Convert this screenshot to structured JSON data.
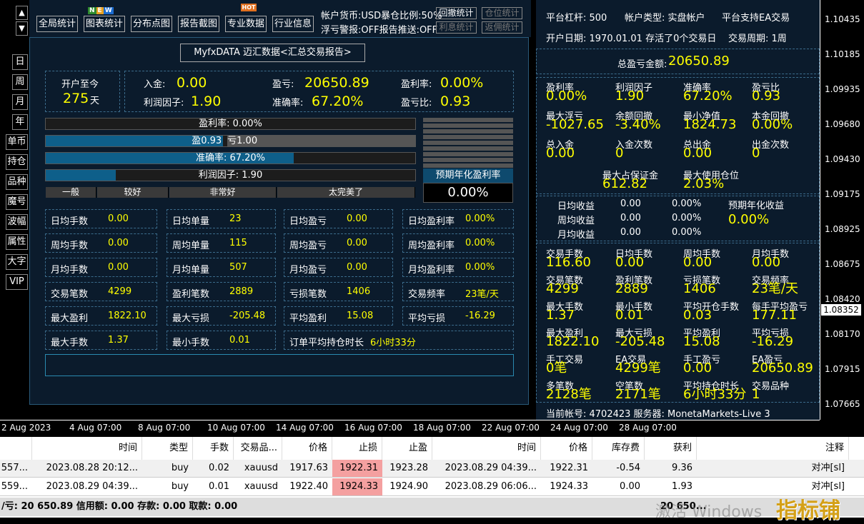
{
  "chart": {
    "price_ticks": [
      "1.10435",
      "1.10185",
      "1.09935",
      "1.09680",
      "1.09430",
      "1.09175",
      "1.08925",
      "1.08675",
      "1.08420",
      "1.08170",
      "1.07915",
      "1.07665"
    ],
    "current_price": "1.08352",
    "time_ticks": [
      "2 Aug 2023",
      "4 Aug 07:00",
      "8 Aug 07:00",
      "10 Aug 07:00",
      "14 Aug 07:00",
      "16 Aug 07:00",
      "18 Aug 07:00",
      "22 Aug 07:00",
      "24 Aug 07:00",
      "28 Aug 07:00"
    ]
  },
  "left_nav": [
    "日",
    "周",
    "月",
    "年",
    "单币",
    "持仓",
    "品种",
    "魔号",
    "波幅",
    "属性",
    "大字",
    "VIP"
  ],
  "toolbar": {
    "buttons": [
      "全局统计",
      "图表统计",
      "分布点图",
      "报告截图",
      "专业数据",
      "行业信息"
    ],
    "new_badge": "NEW",
    "hot_badge": "HOT",
    "info1": "帐户货币:USD暴仓比例:50%",
    "info2": "浮亏警报:OFF报告推送:OFF",
    "btn_recall": "回撤统计",
    "btn_position": "仓位统计",
    "btn_interest": "利息统计",
    "btn_rebate": "返佣统计"
  },
  "report": {
    "title": "MyfxDATA 迈汇数据<汇总交易报告>",
    "since_label": "开户至今",
    "since_value": "275",
    "since_unit": "天",
    "deposit_label": "入金:",
    "deposit_value": "0.00",
    "pnl_label": "盈亏:",
    "pnl_value": "20650.89",
    "profit_rate_label": "盈利率:",
    "profit_rate_value": "0.00%",
    "profit_factor_label": "利润因子:",
    "profit_factor_value": "1.90",
    "accuracy_label": "准确率:",
    "accuracy_value": "67.20%",
    "pl_ratio_label": "盈亏比:",
    "pl_ratio_value": "0.93"
  },
  "bars": {
    "profit_rate": "盈利率: 0.00%",
    "win": "盈0.93",
    "loss": "亏1.00",
    "win_fraction": 0.48,
    "accuracy": "准确率: 67.20%",
    "accuracy_fraction": 0.672,
    "profit_factor": "利润因子: 1.90",
    "profit_factor_fraction": 0.19,
    "levels": [
      "一般",
      "较好",
      "非常好",
      "太完美了"
    ],
    "annual_label": "预期年化盈利率",
    "annual_value": "0.00%"
  },
  "stats": [
    [
      [
        "日均手数",
        "0.00"
      ],
      [
        "日均单量",
        "23"
      ],
      [
        "日均盈亏",
        "0.00"
      ],
      [
        "日均盈利率",
        "0.00%"
      ]
    ],
    [
      [
        "周均手数",
        "0.00"
      ],
      [
        "周均单量",
        "115"
      ],
      [
        "周均盈亏",
        "0.00"
      ],
      [
        "周均盈利率",
        "0.00%"
      ]
    ],
    [
      [
        "月均手数",
        "0.00"
      ],
      [
        "月均单量",
        "507"
      ],
      [
        "月均盈亏",
        "0.00"
      ],
      [
        "月均盈利率",
        "0.00%"
      ]
    ],
    [
      [
        "交易笔数",
        "4299"
      ],
      [
        "盈利笔数",
        "2889"
      ],
      [
        "亏损笔数",
        "1406"
      ],
      [
        "交易频率",
        "23笔/天"
      ]
    ],
    [
      [
        "最大盈利",
        "1822.10"
      ],
      [
        "最大亏损",
        "-205.48"
      ],
      [
        "平均盈利",
        "15.08"
      ],
      [
        "平均亏损",
        "-16.29"
      ]
    ]
  ],
  "stats_last": {
    "max_lots_label": "最大手数",
    "max_lots": "1.37",
    "min_lots_label": "最小手数",
    "min_lots": "0.01",
    "avg_hold_label": "订单平均持仓时长",
    "avg_hold": "6小时33分"
  },
  "right": {
    "leverage": "平台杠杆: 500",
    "acct_type": "帐户类型: 实盘帐户",
    "ea_support": "平台支持EA交易",
    "open_date": "开户日期: 1970.01.01 存活了0个交易日",
    "cycle": "交易周期: 1周",
    "total_pnl_label": "总盈亏金额:",
    "total_pnl": "20650.89",
    "grid1": [
      [
        [
          "盈利率",
          "0.00%"
        ],
        [
          "利润因子",
          "1.90"
        ],
        [
          "准确率",
          "67.20%"
        ],
        [
          "盈亏比",
          "0.93"
        ]
      ],
      [
        [
          "最大浮亏",
          "-1027.65"
        ],
        [
          "余额回撤",
          "-3.40%"
        ],
        [
          "最小净值",
          "1824.73"
        ],
        [
          "本金回撤",
          "0.00%"
        ]
      ],
      [
        [
          "总入金",
          "0.00"
        ],
        [
          "入金次数",
          "0"
        ],
        [
          "总出金",
          "0.00"
        ],
        [
          "出金次数",
          "0"
        ]
      ]
    ],
    "max_margin_label": "最大占保证金",
    "max_margin": "612.82",
    "max_pos_label": "最大使用仓位",
    "max_pos": "2.03%",
    "income": [
      [
        "日均收益",
        "0.00",
        "0.00%"
      ],
      [
        "周均收益",
        "0.00",
        "0.00%"
      ],
      [
        "月均收益",
        "0.00",
        "0.00%"
      ]
    ],
    "annual_label": "预期年化收益",
    "annual_value": "0.00%",
    "grid2": [
      [
        [
          "交易手数",
          "116.60"
        ],
        [
          "日均手数",
          "0.00"
        ],
        [
          "周均手数",
          "0.00"
        ],
        [
          "月均手数",
          "0.00"
        ]
      ],
      [
        [
          "交易笔数",
          "4299"
        ],
        [
          "盈利笔数",
          "2889"
        ],
        [
          "亏损笔数",
          "1406"
        ],
        [
          "交易频率",
          "23笔/天"
        ]
      ],
      [
        [
          "最大手数",
          "1.37"
        ],
        [
          "最小手数",
          "0.01"
        ],
        [
          "平均开仓手数",
          "0.03"
        ],
        [
          "每手平均盈亏",
          "177.11"
        ]
      ],
      [
        [
          "最大盈利",
          "1822.10"
        ],
        [
          "最大亏损",
          "-205.48"
        ],
        [
          "平均盈利",
          "15.08"
        ],
        [
          "平均亏损",
          "-16.29"
        ]
      ],
      [
        [
          "手工交易",
          "0笔"
        ],
        [
          "EA交易",
          "4299笔"
        ],
        [
          "手工盈亏",
          "0.00"
        ],
        [
          "EA盈亏",
          "20650.89"
        ]
      ],
      [
        [
          "多笔数",
          "2128笔"
        ],
        [
          "空笔数",
          "2171笔"
        ],
        [
          "平均持仓时长",
          "6小时33分"
        ],
        [
          "交易品种",
          "1"
        ]
      ]
    ],
    "footer": "当前帐号: 4702423 服务器: MonetaMarkets-Live 3"
  },
  "table": {
    "headers": [
      "",
      "时间",
      "类型",
      "手数",
      "交易品...",
      "价格",
      "止损",
      "止盈",
      "时间",
      "价格",
      "库存费",
      "获利",
      "注释"
    ],
    "rows": [
      [
        "557...",
        "2023.08.28 20:12...",
        "buy",
        "0.02",
        "xauusd",
        "1917.63",
        "1922.31",
        "1923.28",
        "2023.08.29 04:39...",
        "1922.31",
        "-0.54",
        "9.36",
        "对冲[sl]"
      ],
      [
        "559...",
        "2023.08.29 04:39...",
        "buy",
        "0.01",
        "xauusd",
        "1922.40",
        "1924.33",
        "1924.90",
        "2023.08.29 06:06...",
        "1924.33",
        "0.00",
        "1.93",
        "对冲[sl]"
      ]
    ],
    "footer": "/亏: 20 650.89  信用额: 0.00  存款: 0.00  取款: 0.00",
    "footer_total": "20 650..."
  },
  "watermark": "指标铺",
  "activation": "激活 Windows"
}
